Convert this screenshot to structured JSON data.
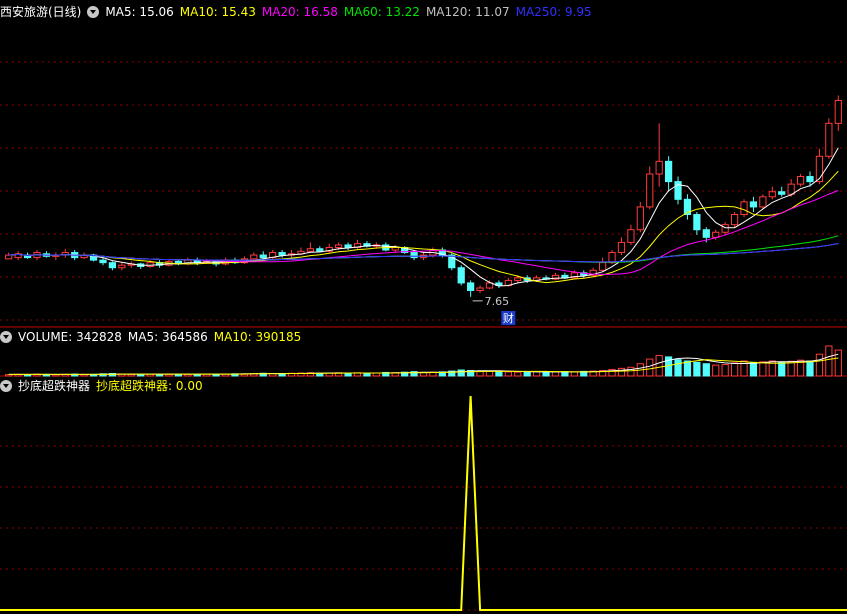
{
  "colors": {
    "background": "#000000",
    "up": "#ff3b3b",
    "down": "#54fcfc",
    "grid": "#8b0000",
    "divider": "#c00000",
    "ma5": "#ffffff",
    "ma10": "#ffff00",
    "ma20": "#ff00ff",
    "ma60": "#00e600",
    "ma120": "#c0c0c0",
    "ma250": "#3030ff",
    "indicator": "#ffff00"
  },
  "price_panel": {
    "stock_name": "西安旅游(日线)",
    "ma5_label": "MA5: 15.06",
    "ma10_label": "MA10: 15.43",
    "ma20_label": "MA20: 16.58",
    "ma60_label": "MA60: 13.22",
    "ma120_label": "MA120: 11.07",
    "ma250_label": "MA250: 9.95",
    "low_marker": "7.65",
    "event_marker": "财"
  },
  "volume_panel": {
    "volume_label": "VOLUME: 342828",
    "ma5_label": "MA5: 364586",
    "ma10_label": "MA10: 390185"
  },
  "indicator_panel": {
    "name": "抄底超跌神器",
    "series_label": "抄底超跌神器: 0.00"
  },
  "chart_data": [
    {
      "type": "candlestick",
      "ylim": [
        6.5,
        18.5
      ],
      "annotations": [
        "7.65",
        "财"
      ],
      "candles": [
        [
          9.15,
          9.3,
          9.2,
          9.4
        ],
        [
          9.2,
          9.35,
          9.1,
          9.45
        ],
        [
          9.3,
          9.2,
          9.15,
          9.4
        ],
        [
          9.2,
          9.4,
          9.1,
          9.5
        ],
        [
          9.35,
          9.25,
          9.2,
          9.45
        ],
        [
          9.25,
          9.3,
          9.1,
          9.4
        ],
        [
          9.3,
          9.4,
          9.2,
          9.55
        ],
        [
          9.4,
          9.2,
          9.1,
          9.5
        ],
        [
          9.2,
          9.3,
          9.15,
          9.4
        ],
        [
          9.3,
          9.1,
          9.05,
          9.35
        ],
        [
          9.1,
          9.0,
          8.9,
          9.2
        ],
        [
          9.0,
          8.8,
          8.7,
          9.05
        ],
        [
          8.8,
          8.9,
          8.7,
          9.0
        ],
        [
          8.9,
          8.95,
          8.8,
          9.05
        ],
        [
          8.95,
          8.85,
          8.75,
          9.0
        ],
        [
          8.85,
          9.0,
          8.8,
          9.1
        ],
        [
          9.0,
          8.9,
          8.8,
          9.1
        ],
        [
          8.9,
          9.05,
          8.85,
          9.15
        ],
        [
          9.05,
          8.95,
          8.9,
          9.1
        ],
        [
          8.95,
          9.1,
          8.9,
          9.2
        ],
        [
          9.1,
          9.0,
          8.9,
          9.2
        ],
        [
          9.0,
          9.05,
          8.95,
          9.15
        ],
        [
          9.05,
          8.95,
          8.85,
          9.1
        ],
        [
          8.95,
          9.1,
          8.9,
          9.2
        ],
        [
          9.1,
          9.0,
          8.95,
          9.2
        ],
        [
          9.0,
          9.15,
          8.95,
          9.25
        ],
        [
          9.15,
          9.3,
          9.1,
          9.4
        ],
        [
          9.3,
          9.2,
          9.1,
          9.45
        ],
        [
          9.2,
          9.4,
          9.15,
          9.5
        ],
        [
          9.4,
          9.3,
          9.2,
          9.5
        ],
        [
          9.3,
          9.35,
          9.2,
          9.5
        ],
        [
          9.35,
          9.45,
          9.3,
          9.6
        ],
        [
          9.45,
          9.55,
          9.4,
          9.8
        ],
        [
          9.55,
          9.45,
          9.4,
          9.65
        ],
        [
          9.45,
          9.6,
          9.4,
          9.75
        ],
        [
          9.6,
          9.7,
          9.5,
          9.8
        ],
        [
          9.7,
          9.6,
          9.5,
          9.8
        ],
        [
          9.6,
          9.75,
          9.55,
          9.9
        ],
        [
          9.75,
          9.65,
          9.6,
          9.85
        ],
        [
          9.65,
          9.7,
          9.55,
          9.8
        ],
        [
          9.7,
          9.5,
          9.45,
          9.8
        ],
        [
          9.5,
          9.6,
          9.4,
          9.7
        ],
        [
          9.6,
          9.4,
          9.35,
          9.65
        ],
        [
          9.4,
          9.2,
          9.1,
          9.5
        ],
        [
          9.2,
          9.3,
          9.1,
          9.4
        ],
        [
          9.3,
          9.5,
          9.2,
          9.6
        ],
        [
          9.5,
          9.3,
          9.2,
          9.6
        ],
        [
          9.3,
          8.8,
          8.7,
          9.4
        ],
        [
          8.8,
          8.2,
          8.1,
          8.9
        ],
        [
          8.2,
          7.9,
          7.65,
          8.3
        ],
        [
          7.9,
          8.0,
          7.8,
          8.1
        ],
        [
          8.0,
          8.2,
          7.95,
          8.3
        ],
        [
          8.2,
          8.1,
          8.0,
          8.3
        ],
        [
          8.1,
          8.3,
          8.05,
          8.4
        ],
        [
          8.3,
          8.4,
          8.2,
          8.5
        ],
        [
          8.4,
          8.3,
          8.2,
          8.5
        ],
        [
          8.3,
          8.4,
          8.25,
          8.5
        ],
        [
          8.4,
          8.35,
          8.3,
          8.5
        ],
        [
          8.35,
          8.5,
          8.3,
          8.6
        ],
        [
          8.5,
          8.4,
          8.35,
          8.6
        ],
        [
          8.4,
          8.6,
          8.35,
          8.7
        ],
        [
          8.6,
          8.5,
          8.4,
          8.7
        ],
        [
          8.5,
          8.7,
          8.45,
          8.8
        ],
        [
          8.7,
          9.0,
          8.65,
          9.2
        ],
        [
          9.0,
          9.4,
          8.95,
          9.5
        ],
        [
          9.4,
          9.8,
          9.3,
          10.0
        ],
        [
          9.8,
          10.3,
          9.7,
          10.5
        ],
        [
          10.3,
          11.2,
          10.2,
          11.4
        ],
        [
          11.2,
          12.5,
          11.1,
          12.8
        ],
        [
          12.5,
          13.0,
          12.0,
          14.5
        ],
        [
          13.0,
          12.2,
          11.8,
          13.2
        ],
        [
          12.2,
          11.5,
          11.3,
          12.4
        ],
        [
          11.5,
          10.9,
          10.7,
          11.7
        ],
        [
          10.9,
          10.3,
          10.1,
          11.0
        ],
        [
          10.3,
          10.0,
          9.8,
          10.4
        ],
        [
          10.0,
          10.2,
          9.9,
          10.3
        ],
        [
          10.2,
          10.5,
          10.1,
          10.6
        ],
        [
          10.5,
          10.9,
          10.4,
          11.0
        ],
        [
          10.9,
          11.4,
          10.8,
          11.5
        ],
        [
          11.4,
          11.2,
          11.0,
          11.6
        ],
        [
          11.2,
          11.6,
          11.1,
          11.7
        ],
        [
          11.6,
          11.8,
          11.5,
          12.0
        ],
        [
          11.8,
          11.7,
          11.6,
          12.0
        ],
        [
          11.7,
          12.1,
          11.6,
          12.3
        ],
        [
          12.1,
          12.4,
          12.0,
          12.5
        ],
        [
          12.4,
          12.2,
          12.0,
          12.6
        ],
        [
          12.2,
          13.2,
          12.1,
          13.5
        ],
        [
          13.2,
          14.5,
          13.1,
          14.7
        ],
        [
          14.5,
          15.4,
          14.2,
          15.6
        ]
      ]
    },
    {
      "type": "bar",
      "name": "VOLUME",
      "values": [
        5,
        6,
        5,
        7,
        6,
        5,
        6,
        7,
        5,
        6,
        8,
        9,
        7,
        6,
        6,
        7,
        6,
        6,
        7,
        6,
        6,
        7,
        6,
        7,
        8,
        7,
        9,
        10,
        9,
        8,
        10,
        11,
        12,
        10,
        11,
        12,
        11,
        12,
        10,
        11,
        13,
        12,
        14,
        16,
        13,
        14,
        15,
        18,
        22,
        20,
        18,
        17,
        16,
        15,
        14,
        15,
        16,
        14,
        15,
        16,
        15,
        17,
        18,
        20,
        24,
        28,
        32,
        45,
        62,
        75,
        70,
        60,
        55,
        50,
        45,
        40,
        42,
        48,
        55,
        50,
        52,
        55,
        50,
        54,
        58,
        55,
        80,
        110,
        95
      ],
      "ma5": [
        6,
        6,
        6,
        6,
        6,
        6,
        6,
        6,
        6,
        6,
        7,
        7,
        7,
        7,
        7,
        7,
        7,
        7,
        7,
        7,
        7,
        7,
        7,
        7,
        7,
        8,
        8,
        9,
        9,
        9,
        9,
        9,
        10,
        10,
        11,
        11,
        11,
        11,
        11,
        11,
        11,
        12,
        12,
        13,
        14,
        14,
        14,
        15,
        16,
        18,
        19,
        19,
        19,
        18,
        17,
        16,
        15,
        15,
        15,
        15,
        15,
        15,
        16,
        17,
        19,
        21,
        24,
        29,
        36,
        48,
        58,
        64,
        66,
        64,
        58,
        52,
        48,
        46,
        46,
        47,
        49,
        52,
        52,
        52,
        54,
        54,
        59,
        71,
        80
      ],
      "ma10": [
        6,
        6,
        6,
        6,
        6,
        6,
        6,
        6,
        6,
        6,
        6,
        6,
        7,
        7,
        7,
        7,
        7,
        7,
        7,
        7,
        7,
        7,
        7,
        7,
        7,
        7,
        8,
        8,
        8,
        8,
        9,
        9,
        9,
        10,
        10,
        10,
        11,
        11,
        11,
        11,
        11,
        11,
        12,
        12,
        12,
        13,
        13,
        14,
        15,
        16,
        16,
        17,
        17,
        17,
        17,
        17,
        17,
        17,
        16,
        16,
        15,
        15,
        15,
        16,
        17,
        18,
        19,
        22,
        26,
        32,
        38,
        45,
        51,
        56,
        60,
        58,
        56,
        54,
        52,
        50,
        48,
        47,
        47,
        48,
        50,
        52,
        55,
        61,
        66
      ]
    },
    {
      "type": "line",
      "name": "抄底超跌神器",
      "ylim": [
        0,
        1
      ],
      "values": [
        0,
        0,
        0,
        0,
        0,
        0,
        0,
        0,
        0,
        0,
        0,
        0,
        0,
        0,
        0,
        0,
        0,
        0,
        0,
        0,
        0,
        0,
        0,
        0,
        0,
        0,
        0,
        0,
        0,
        0,
        0,
        0,
        0,
        0,
        0,
        0,
        0,
        0,
        0,
        0,
        0,
        0,
        0,
        0,
        0,
        0,
        0,
        0,
        0,
        1,
        0,
        0,
        0,
        0,
        0,
        0,
        0,
        0,
        0,
        0,
        0,
        0,
        0,
        0,
        0,
        0,
        0,
        0,
        0,
        0,
        0,
        0,
        0,
        0,
        0,
        0,
        0,
        0,
        0,
        0,
        0,
        0,
        0,
        0,
        0,
        0,
        0,
        0,
        0
      ]
    }
  ]
}
